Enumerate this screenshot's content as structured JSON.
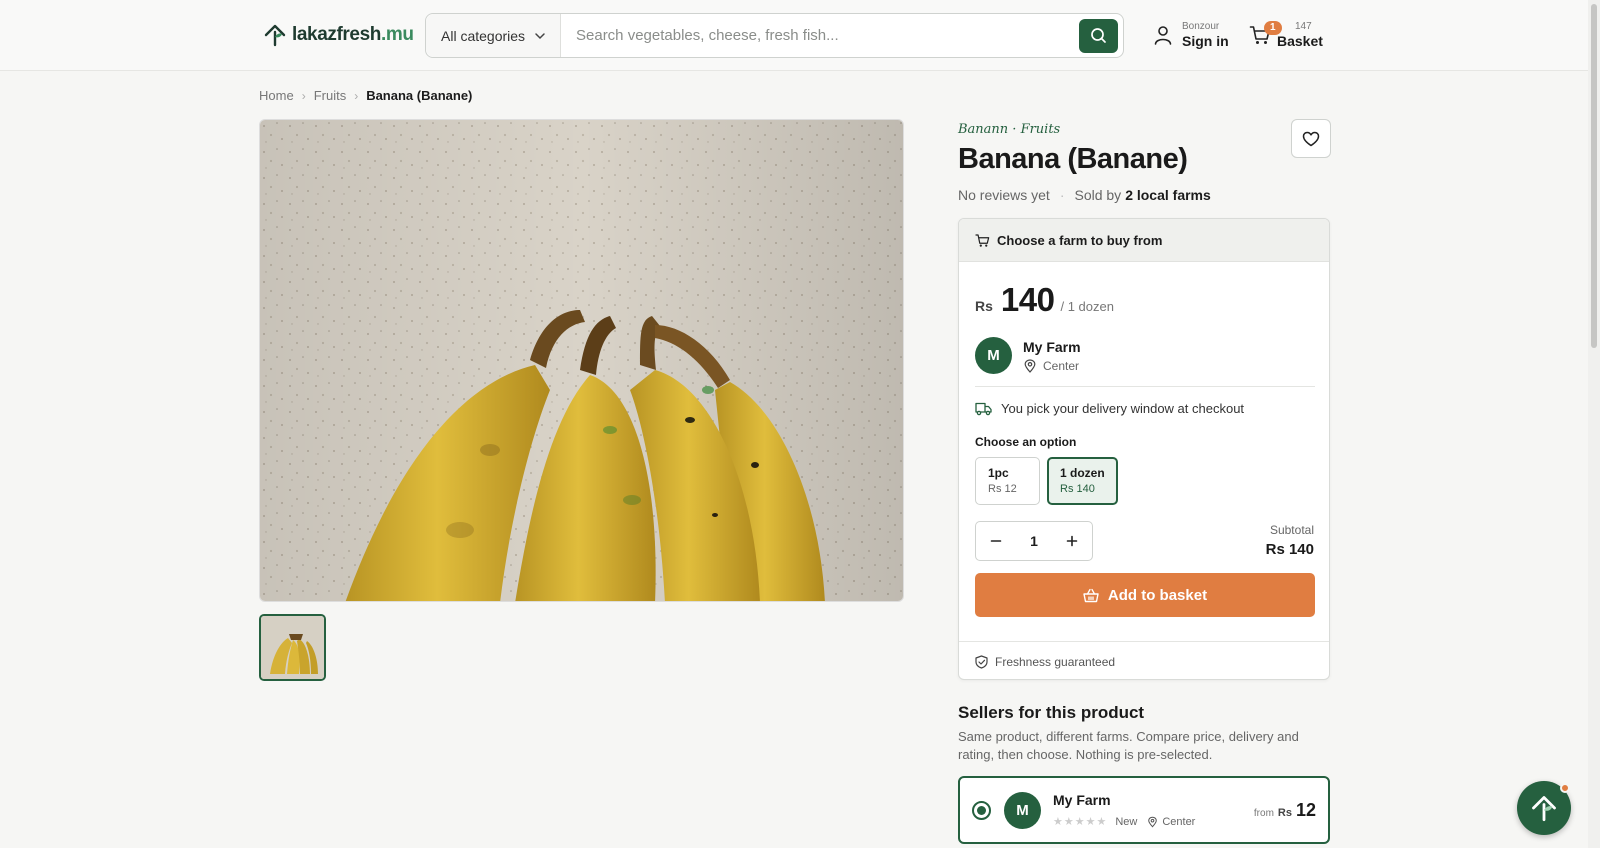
{
  "header": {
    "logo": {
      "name": "lakazfresh",
      "tld": ".mu"
    },
    "category_select": "All categories",
    "search_placeholder": "Search vegetables, cheese, fresh fish...",
    "signin": {
      "greeting": "Bonzour",
      "label": "Sign in"
    },
    "basket": {
      "badge": "1",
      "amount": "147",
      "label": "Basket"
    }
  },
  "breadcrumb": [
    "Home",
    "Fruits",
    "Banana (Banane)"
  ],
  "product": {
    "eyebrow": "Banann · Fruits",
    "title": "Banana (Banane)",
    "reviews": "No reviews yet",
    "sold_by_prefix": "Sold by",
    "sold_by_value": "2 local farms"
  },
  "buy_card": {
    "heading": "Choose a farm to buy from",
    "currency": "Rs",
    "price": "140",
    "unit": "/ 1 dozen",
    "farm": {
      "initial": "M",
      "name": "My Farm",
      "location": "Center"
    },
    "delivery_note": "You pick your delivery window at checkout",
    "option_label": "Choose an option",
    "options": [
      {
        "name": "1pc",
        "price": "Rs 12",
        "selected": false
      },
      {
        "name": "1 dozen",
        "price": "Rs 140",
        "selected": true
      }
    ],
    "quantity": "1",
    "subtotal_label": "Subtotal",
    "subtotal_value": "Rs 140",
    "add_button": "Add to basket",
    "freshness": "Freshness guaranteed"
  },
  "sellers": {
    "title": "Sellers for this product",
    "description": "Same product, different farms. Compare price, delivery and rating, then choose. Nothing is pre-selected.",
    "items": [
      {
        "initial": "M",
        "name": "My Farm",
        "stars": "★★★★★",
        "badge": "New",
        "location": "Center",
        "from": "from",
        "currency": "Rs",
        "price": "12"
      }
    ]
  },
  "colors": {
    "brand": "#25603f",
    "accent": "#e07d41"
  },
  "icons": [
    "logo-sprout-icon",
    "chevron-down-icon",
    "search-icon",
    "user-icon",
    "cart-icon",
    "heart-icon",
    "map-pin-icon",
    "truck-icon",
    "minus-icon",
    "plus-icon",
    "basket-icon",
    "shield-check-icon",
    "chat-sprout-icon"
  ]
}
